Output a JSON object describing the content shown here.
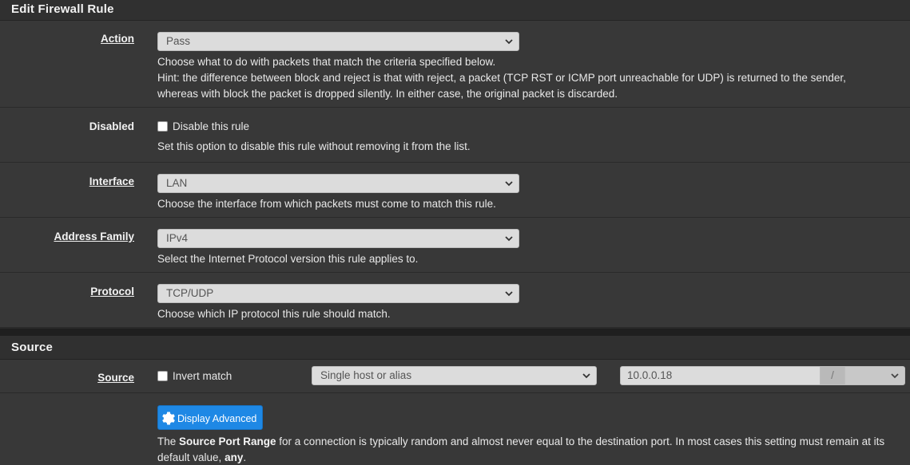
{
  "section_edit": {
    "title": "Edit Firewall Rule"
  },
  "action": {
    "label": "Action",
    "value": "Pass",
    "help1": "Choose what to do with packets that match the criteria specified below.",
    "help2": "Hint: the difference between block and reject is that with reject, a packet (TCP RST or ICMP port unreachable for UDP) is returned to the sender,",
    "help3": "whereas with block the packet is dropped silently. In either case, the original packet is discarded."
  },
  "disabled": {
    "label": "Disabled",
    "checkbox_label": "Disable this rule",
    "checked": false,
    "help": "Set this option to disable this rule without removing it from the list."
  },
  "interface": {
    "label": "Interface",
    "value": "LAN",
    "help": "Choose the interface from which packets must come to match this rule."
  },
  "address_family": {
    "label": "Address Family",
    "value": "IPv4",
    "help": "Select the Internet Protocol version this rule applies to."
  },
  "protocol": {
    "label": "Protocol",
    "value": "TCP/UDP",
    "help": "Choose which IP protocol this rule should match."
  },
  "section_source": {
    "title": "Source"
  },
  "source": {
    "label": "Source",
    "invert_label": "Invert match",
    "invert_checked": false,
    "type_value": "Single host or alias",
    "address_value": "10.0.0.18",
    "slash": "/",
    "mask_value": ""
  },
  "advanced": {
    "button_label": "Display Advanced",
    "help_pre": "The ",
    "help_bold": "Source Port Range",
    "help_mid": " for a connection is typically random and almost never equal to the destination port. In most cases this setting must remain at its default value, ",
    "help_bold2": "any",
    "help_end": "."
  },
  "colors": {
    "accent": "#1e88e5",
    "panel": "#383838",
    "heading": "#303030"
  },
  "icons": {
    "select_arrow": "chevron-down-icon",
    "advanced": "gear-icon"
  }
}
